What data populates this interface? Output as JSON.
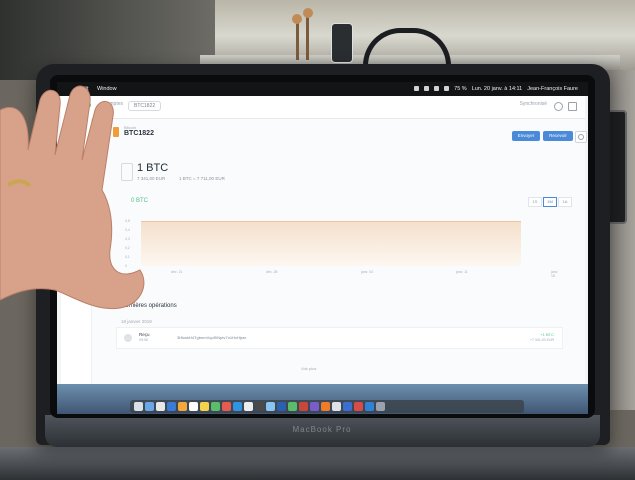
{
  "menubar": {
    "app_name": "Edit",
    "menu_item": "Window",
    "battery": "75 %",
    "clock": "Lun. 20 janv. à 14:11",
    "user": "Jean-François Faure"
  },
  "window": {
    "breadcrumb": [
      "Comptes",
      "BTC1822"
    ],
    "sync_label": "Synchronisé"
  },
  "account": {
    "type_label": "Bitcoin",
    "name": "BTC1822",
    "send_label": "Envoyer",
    "receive_label": "Recevoir",
    "balance": "1 BTC",
    "countervalue": "7 341,00 EUR",
    "rate": "1 BTC = 7 711,00 EUR",
    "change": "0 BTC",
    "ranges": [
      "1S",
      "1M",
      "1A"
    ],
    "active_range": "1M"
  },
  "chart_data": {
    "type": "area",
    "x": [
      "déc. 21",
      "déc. 28",
      "janv. 04",
      "janv. 11",
      "janv. 18"
    ],
    "y_ticks": [
      "0,5",
      "0,4",
      "0,3",
      "0,2",
      "0,1",
      "0"
    ],
    "series": [
      {
        "values": [
          1,
          1,
          1,
          1,
          1
        ]
      }
    ]
  },
  "operations": {
    "title": "Dernières opérations",
    "date": "18 janvier 2019",
    "rows": [
      {
        "type": "Reçu",
        "time": "09:06",
        "address": "3HkwkH4TgbnmVqoSiNptv7o1HcHjsrn",
        "amount": "+1 BTC",
        "value": "+7 341,00 EUR"
      }
    ],
    "see_more": "Voir plus"
  },
  "laptop": {
    "model": "MacBook Pro"
  },
  "colors": {
    "accent": "#4a8ad8",
    "bitcoin": "#f29c38",
    "positive": "#55c08b"
  }
}
